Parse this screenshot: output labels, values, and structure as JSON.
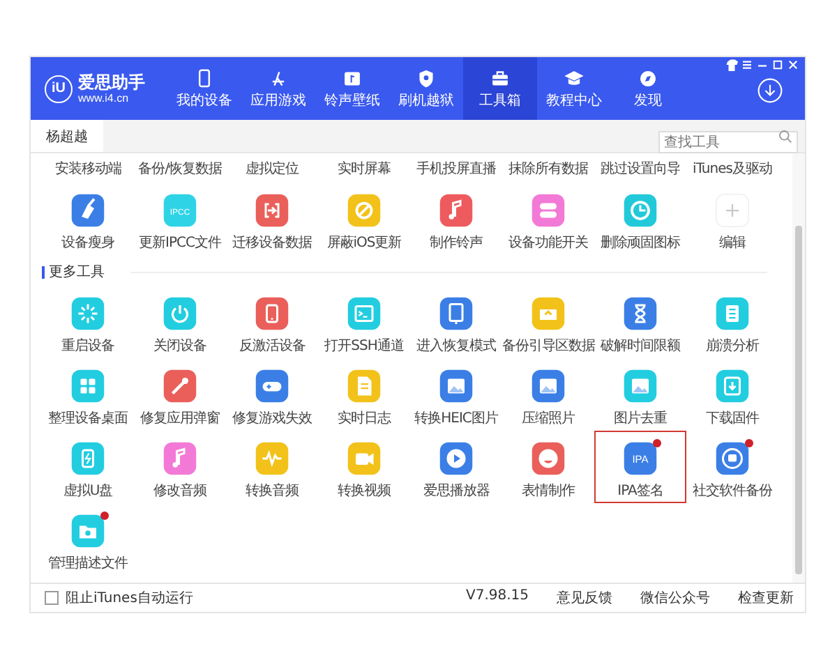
{
  "app": {
    "logo_mark": "iU",
    "name": "爱思助手",
    "site": "www.i4.cn"
  },
  "nav": [
    {
      "label": "我的设备",
      "kind": "phone",
      "selected": false
    },
    {
      "label": "应用游戏",
      "kind": "appstore",
      "selected": false
    },
    {
      "label": "铃声壁纸",
      "kind": "picture",
      "selected": false
    },
    {
      "label": "刷机越狱",
      "kind": "shield",
      "selected": false
    },
    {
      "label": "工具箱",
      "kind": "toolbox",
      "selected": true
    },
    {
      "label": "教程中心",
      "kind": "cap",
      "selected": false
    },
    {
      "label": "发现",
      "kind": "compass",
      "selected": false
    }
  ],
  "tabs": [
    {
      "label": "杨超越",
      "selected": true
    }
  ],
  "search": {
    "placeholder": "查找工具"
  },
  "scrolled_labels": [
    "安装移动端",
    "备份/恢复数据",
    "虚拟定位",
    "实时屏幕",
    "手机投屏直播",
    "抹除所有数据",
    "跳过设置向导",
    "iTunes及驱动"
  ],
  "my_tools": [
    {
      "label": "设备瘦身",
      "kind": "broom",
      "color": "#3b7fe6",
      "badge": false,
      "selected": false
    },
    {
      "label": "更新IPCC文件",
      "kind": "text",
      "glyph": "IPCC",
      "color": "#2fd3e6",
      "badge": false,
      "selected": false
    },
    {
      "label": "迁移设备数据",
      "kind": "transfer",
      "color": "#ea5f5a",
      "badge": false,
      "selected": false
    },
    {
      "label": "屏蔽iOS更新",
      "kind": "block",
      "color": "#f2c21a",
      "badge": false,
      "selected": false
    },
    {
      "label": "制作铃声",
      "kind": "note",
      "color": "#ee5b5e",
      "badge": false,
      "selected": false
    },
    {
      "label": "设备功能开关",
      "kind": "toggles",
      "color": "#f27ad6",
      "badge": false,
      "selected": false
    },
    {
      "label": "删除顽固图标",
      "kind": "clock",
      "color": "#22c9d9",
      "badge": false,
      "selected": false
    },
    {
      "label": "编辑",
      "kind": "plus",
      "color": "#ffffff",
      "badge": false,
      "selected": false
    }
  ],
  "more_tools": {
    "title": "更多工具",
    "items": [
      {
        "label": "重启设备",
        "kind": "burst",
        "color": "#22cde0",
        "badge": false,
        "selected": false
      },
      {
        "label": "关闭设备",
        "kind": "power",
        "color": "#22cde0",
        "badge": false,
        "selected": false
      },
      {
        "label": "反激活设备",
        "kind": "phone",
        "color": "#ea5f5a",
        "badge": false,
        "selected": false
      },
      {
        "label": "打开SSH通道",
        "kind": "terminal",
        "color": "#22cde0",
        "badge": false,
        "selected": false
      },
      {
        "label": "进入恢复模式",
        "kind": "tablet",
        "color": "#3b7fe6",
        "badge": false,
        "selected": false
      },
      {
        "label": "备份引导区数据",
        "kind": "tray",
        "color": "#f2c21a",
        "badge": false,
        "selected": false
      },
      {
        "label": "破解时间限额",
        "kind": "hourglass",
        "color": "#3b7fe6",
        "badge": false,
        "selected": false
      },
      {
        "label": "崩溃分析",
        "kind": "list",
        "color": "#22cde0",
        "badge": false,
        "selected": false
      },
      {
        "label": "整理设备桌面",
        "kind": "grid",
        "color": "#22cde0",
        "badge": false,
        "selected": false
      },
      {
        "label": "修复应用弹窗",
        "kind": "wrench",
        "color": "#ea5f5a",
        "badge": false,
        "selected": false
      },
      {
        "label": "修复游戏失效",
        "kind": "gamepad",
        "color": "#3b7fe6",
        "badge": false,
        "selected": false
      },
      {
        "label": "实时日志",
        "kind": "doc",
        "color": "#f2c21a",
        "badge": false,
        "selected": false
      },
      {
        "label": "转换HEIC图片",
        "kind": "image",
        "color": "#3b7fe6",
        "badge": false,
        "selected": false
      },
      {
        "label": "压缩照片",
        "kind": "image",
        "color": "#3b7fe6",
        "badge": false,
        "selected": false
      },
      {
        "label": "图片去重",
        "kind": "image",
        "color": "#22cde0",
        "badge": false,
        "selected": false
      },
      {
        "label": "下载固件",
        "kind": "download",
        "color": "#22cde0",
        "badge": false,
        "selected": false
      },
      {
        "label": "虚拟U盘",
        "kind": "battery",
        "color": "#22cde0",
        "badge": false,
        "selected": false
      },
      {
        "label": "修改音频",
        "kind": "note",
        "color": "#f27ad6",
        "badge": false,
        "selected": false
      },
      {
        "label": "转换音频",
        "kind": "wave",
        "color": "#f2c21a",
        "badge": false,
        "selected": false
      },
      {
        "label": "转换视频",
        "kind": "camera",
        "color": "#f2c21a",
        "badge": false,
        "selected": false
      },
      {
        "label": "爱思播放器",
        "kind": "play",
        "color": "#3b7fe6",
        "badge": false,
        "selected": false
      },
      {
        "label": "表情制作",
        "kind": "smile",
        "color": "#ea5f5a",
        "badge": false,
        "selected": false
      },
      {
        "label": "IPA签名",
        "kind": "text",
        "glyph": "IPA",
        "color": "#3b7fe6",
        "badge": true,
        "selected": true
      },
      {
        "label": "社交软件备份",
        "kind": "chat",
        "color": "#3b7fe6",
        "badge": true,
        "selected": false
      },
      {
        "label": "管理描述文件",
        "kind": "folder",
        "color": "#22cde0",
        "badge": true,
        "selected": false
      }
    ]
  },
  "footer": {
    "block_itunes": {
      "label": "阻止iTunes自动运行",
      "checked": false
    },
    "version": "V7.98.15",
    "links": [
      "意见反馈",
      "微信公众号",
      "检查更新"
    ]
  }
}
